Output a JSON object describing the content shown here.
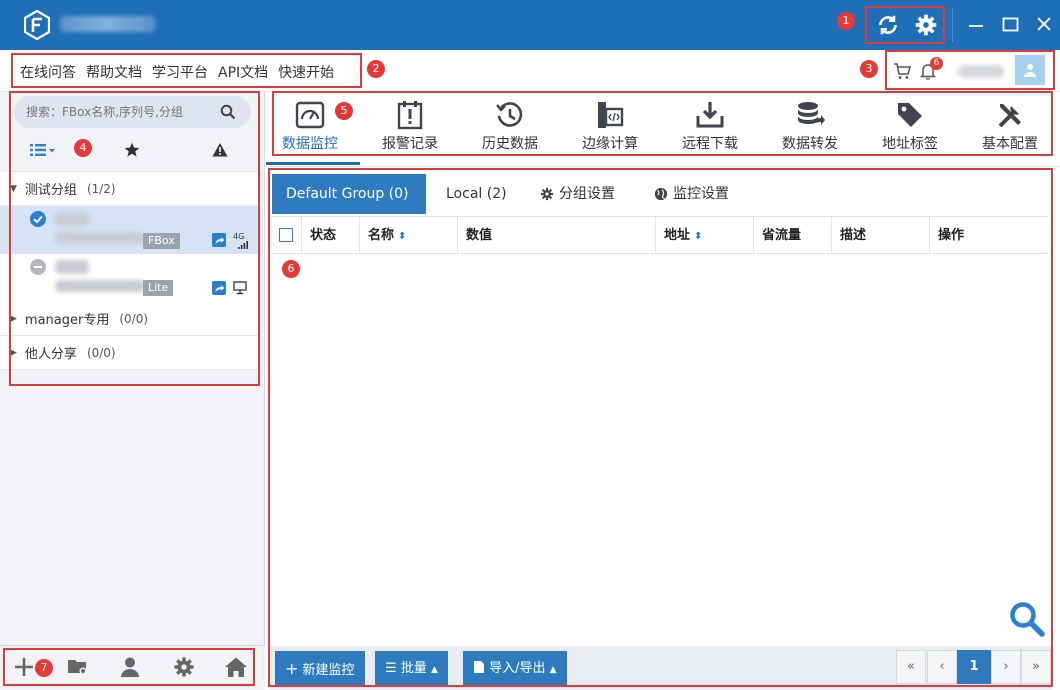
{
  "help_links": [
    "在线问答",
    "帮助文档",
    "学习平台",
    "API文档",
    "快速开始"
  ],
  "notifications": {
    "count": "6"
  },
  "search": {
    "placeholder": "搜索：FBox名称,序列号,分组"
  },
  "groups": [
    {
      "name": "测试分组",
      "count": "(1/2)"
    },
    {
      "name": "manager专用",
      "count": "(0/0)"
    },
    {
      "name": "他人分享",
      "count": "(0/0)"
    }
  ],
  "devices": [
    {
      "type": "FBox",
      "signal": "4G",
      "status": "online"
    },
    {
      "type": "Lite",
      "status": "offline"
    }
  ],
  "function_tabs": [
    "数据监控",
    "报警记录",
    "历史数据",
    "边缘计算",
    "远程下载",
    "数据转发",
    "地址标签",
    "基本配置"
  ],
  "group_tabs": [
    "Default Group (0)",
    "Local (2)",
    "分组设置",
    "监控设置"
  ],
  "table_headers": [
    "状态",
    "名称",
    "数值",
    "地址",
    "省流量",
    "描述",
    "操作"
  ],
  "footer_buttons": [
    "新建监控",
    "批量",
    "导入/导出"
  ],
  "pagination": {
    "first": "«",
    "prev": "‹",
    "current": "1",
    "next": "›",
    "last": "»"
  },
  "annotations": [
    "1",
    "2",
    "3",
    "4",
    "5",
    "6",
    "7"
  ],
  "colors": {
    "title_bar": "#1e6fb8",
    "accent": "#2f7bbf",
    "annotation": "#e03a3a"
  }
}
